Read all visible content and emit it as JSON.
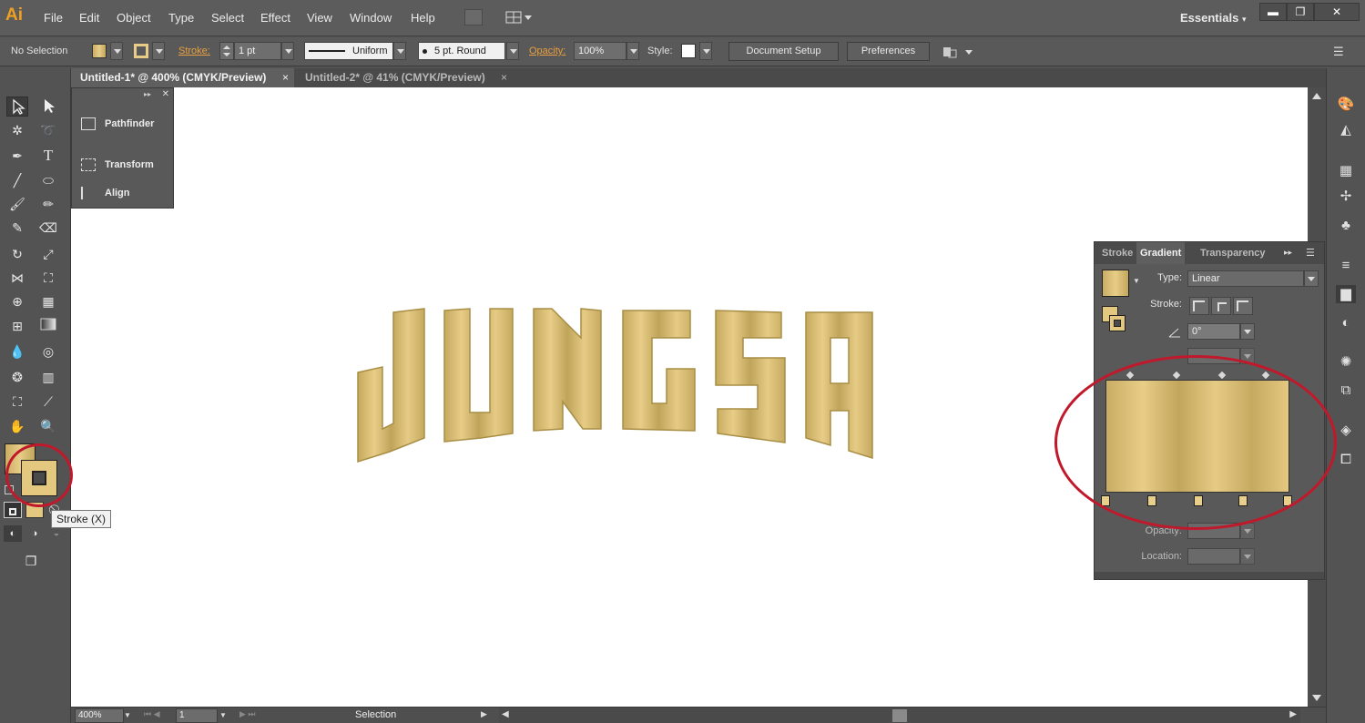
{
  "app": {
    "logo": "Ai",
    "workspace": "Essentials"
  },
  "menu": [
    "File",
    "Edit",
    "Object",
    "Type",
    "Select",
    "Effect",
    "View",
    "Window",
    "Help"
  ],
  "window_controls": {
    "minimize": "▬",
    "restore": "❐",
    "close": "✕"
  },
  "control_bar": {
    "selection": "No Selection",
    "stroke_label": "Stroke:",
    "stroke_weight": "1 pt",
    "profile": "Uniform",
    "brush": "5 pt. Round",
    "opacity_label": "Opacity:",
    "opacity": "100%",
    "style_label": "Style:",
    "document_setup": "Document Setup",
    "preferences": "Preferences"
  },
  "tabs": [
    {
      "title": "Untitled-1* @ 400% (CMYK/Preview)",
      "close": "×"
    },
    {
      "title": "Untitled-2* @ 41% (CMYK/Preview)",
      "close": "×"
    }
  ],
  "artwork": {
    "text": "JUNGSA",
    "colors": {
      "gold_light": "#e8cd88",
      "gold_dark": "#bfa45a"
    }
  },
  "float_panel": {
    "items": [
      "Pathfinder",
      "Transform",
      "Align"
    ]
  },
  "gradient_panel": {
    "tabs": [
      "Stroke",
      "Gradient",
      "Transparency"
    ],
    "type_label": "Type:",
    "type": "Linear",
    "stroke_label": "Stroke:",
    "angle": "0°",
    "opacity_label": "Opacity:",
    "location_label": "Location:"
  },
  "tooltip": "Stroke (X)",
  "status_bar": {
    "zoom": "400%",
    "page": "1",
    "tool": "Selection"
  },
  "annotation_color": "#c0192b"
}
